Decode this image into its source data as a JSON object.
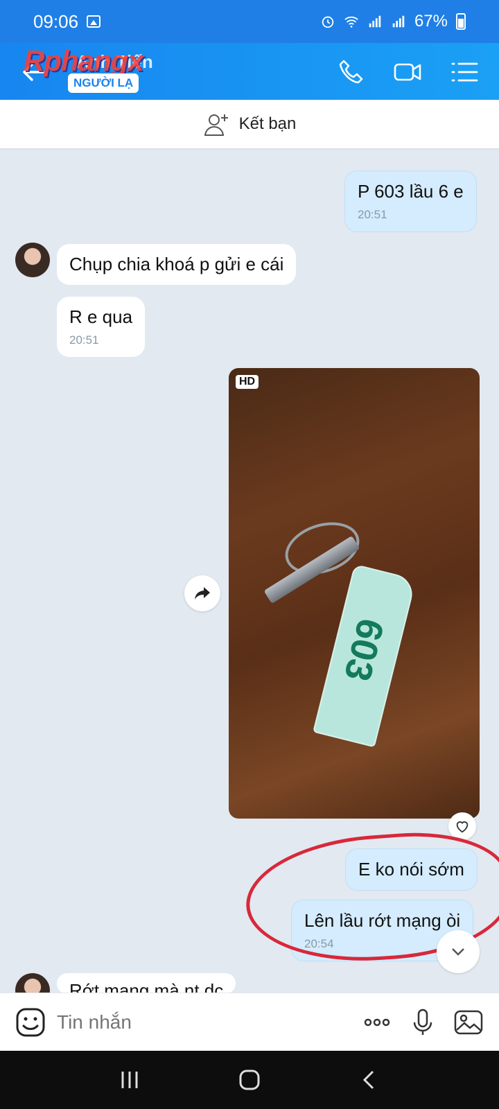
{
  "status": {
    "time": "09:06",
    "battery": "67%"
  },
  "header": {
    "contact_name": "Anh Tiến",
    "badge": "NGƯỜI LẠ",
    "watermark": "Rphangx"
  },
  "friend_bar": {
    "label": "Kết bạn"
  },
  "messages": [
    {
      "dir": "out",
      "text": "P 603 lầu 6 e",
      "time": "20:51"
    },
    {
      "dir": "in",
      "text": "Chụp chia khoá p gửi e cái"
    },
    {
      "dir": "in",
      "text": "R e qua",
      "time": "20:51"
    },
    {
      "dir": "out",
      "type": "photo",
      "hd": "HD",
      "tag_number": "603"
    },
    {
      "dir": "out",
      "text": "E ko nói sớm"
    },
    {
      "dir": "out",
      "text": "Lên lầu rớt mạng òi",
      "time": "20:54"
    },
    {
      "dir": "in",
      "text": "Rớt mạng mà nt dc"
    }
  ],
  "input": {
    "placeholder": "Tin nhắn"
  },
  "icons": {
    "back": "arrow-left-icon",
    "call": "phone-icon",
    "video": "video-camera-icon",
    "menu": "list-menu-icon",
    "add_friend": "add-user-icon",
    "forward": "forward-icon",
    "react": "heart-icon",
    "scroll_down": "chevron-down-icon",
    "sticker": "sticker-icon",
    "more": "more-dots-icon",
    "mic": "microphone-icon",
    "image": "image-icon"
  },
  "colors": {
    "header": "#1786f0",
    "out_bubble": "#d4ecfd",
    "in_bubble": "#ffffff",
    "annotation": "#d8283a"
  }
}
